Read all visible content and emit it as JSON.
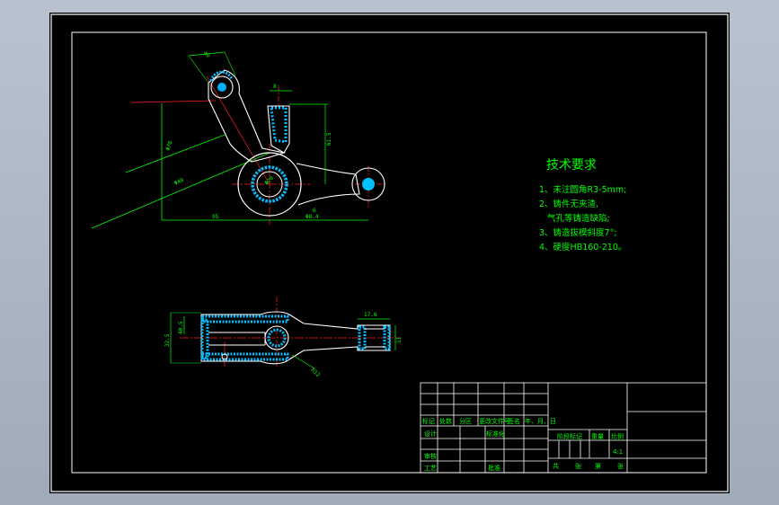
{
  "tech_requirements": {
    "title": "技术要求",
    "lines": [
      "1、未注圆角R3-5mm;",
      "2、铸件无夹渣,",
      "气孔等铸造缺陷;",
      "3、铸造拔模斜度7°;",
      "4、硬度HB160-210。"
    ]
  },
  "dimensions": {
    "top_view": [
      "40",
      "8",
      "61.5",
      "Φ70",
      "Φ20",
      "Φ40",
      "95",
      "6",
      "Φ8.4"
    ],
    "bottom_view": [
      "17.6",
      "32.5",
      "40.5",
      "11",
      "R12"
    ]
  },
  "title_block": {
    "row_labels": [
      "标记",
      "处数",
      "分区",
      "更改文件号",
      "签名",
      "年、月、日"
    ],
    "design": "设计",
    "standardize": "标准化",
    "review": "审核",
    "process": "工艺",
    "approve": "批准",
    "stage_mark": "阶段标记",
    "weight": "重量",
    "scale": "比例",
    "scale_value": "4:1",
    "sheets_total": "共",
    "sheets_unit": "张",
    "sheet_no": "第",
    "sheet_unit2": "张"
  },
  "colors": {
    "background": "#000000",
    "frame": "#ffffff",
    "text": "#00ff00",
    "hatch": "#00c0ff",
    "center_line": "#ff2020",
    "dimension": "#00ff00"
  }
}
